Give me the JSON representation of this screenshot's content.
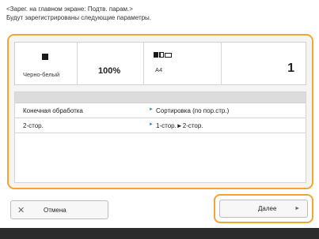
{
  "header": {
    "line1": "<Зарег. на главном экране: Подтв. парам.>",
    "line2": "Будут зарегистрированы следующие параметры."
  },
  "settings": {
    "color_mode": "Черно-белый",
    "zoom": "100%",
    "paper": "A4",
    "copies": "1"
  },
  "options": [
    {
      "name": "Конечная обработка",
      "value": "Сортировка (по пор.стр.)"
    },
    {
      "name": "2-стор.",
      "value": "1-стор.►2-стор."
    }
  ],
  "buttons": {
    "cancel": "Отмена",
    "next": "Далее"
  },
  "colors": {
    "highlight": "#f2a531",
    "arrow": "#2b8fd1",
    "bottom_bar": "#2c2c2c"
  }
}
